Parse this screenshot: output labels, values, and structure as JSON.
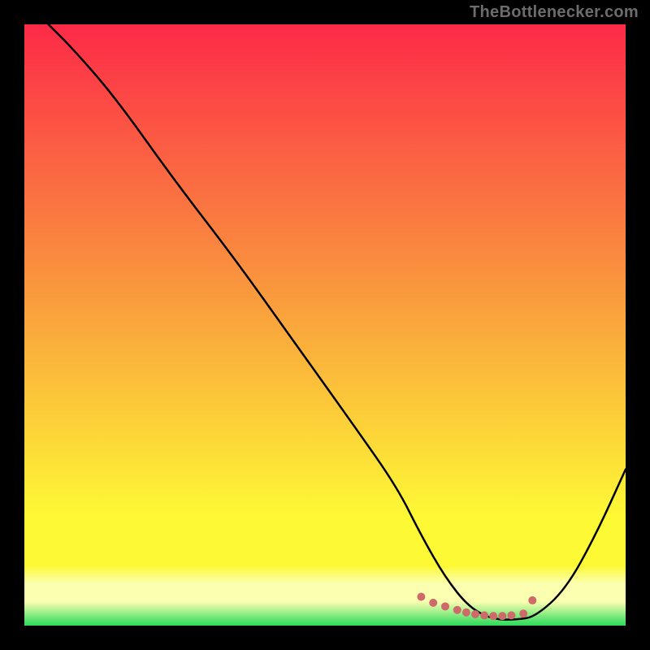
{
  "attribution": "TheBottlenecker.com",
  "chart_data": {
    "type": "line",
    "title": "",
    "xlabel": "",
    "ylabel": "",
    "xlim": [
      0,
      100
    ],
    "ylim": [
      0,
      100
    ],
    "grid": false,
    "legend": false,
    "background_gradient": {
      "top_color": "#fd2a48",
      "mid_upper_color": "#f99a3d",
      "mid_lower_color": "#fef935",
      "band_color": "#fbffb0",
      "bottom_color": "#2ada5a"
    },
    "series": [
      {
        "name": "bottleneck-curve",
        "color": "#000000",
        "x": [
          4,
          8,
          15,
          25,
          35,
          45,
          55,
          62,
          66,
          70,
          74,
          78,
          82,
          85,
          90,
          95,
          100
        ],
        "y": [
          100,
          96,
          88,
          74,
          61,
          47,
          33,
          23,
          15,
          8,
          3,
          1,
          1,
          1.5,
          6,
          15,
          26
        ]
      }
    ],
    "valley_markers": {
      "color": "#cf6a6a",
      "radius": 5,
      "points_x": [
        66,
        68,
        70,
        72,
        73.5,
        75,
        76.5,
        78,
        79.5,
        81,
        83,
        84.5
      ],
      "points_y": [
        4.8,
        3.8,
        3.2,
        2.6,
        2.2,
        1.9,
        1.7,
        1.6,
        1.6,
        1.7,
        2.0,
        4.2
      ]
    }
  }
}
